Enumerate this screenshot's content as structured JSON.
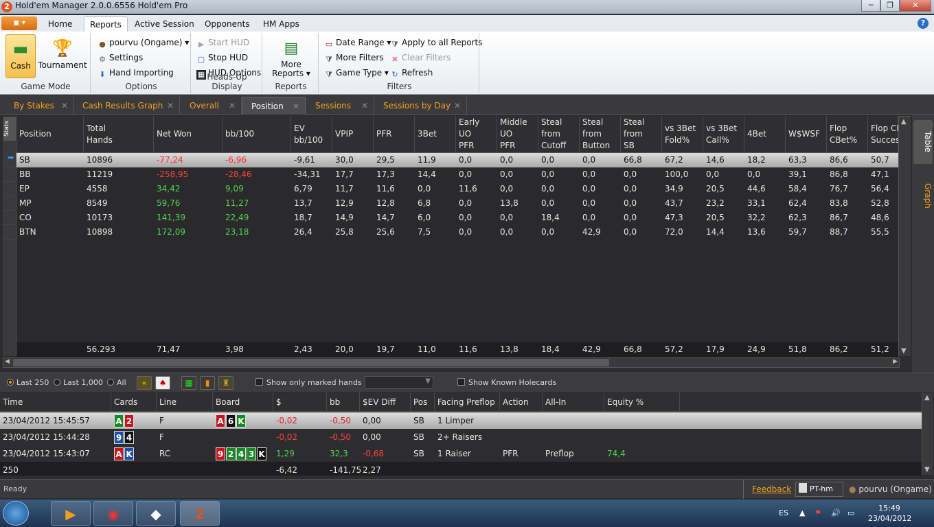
{
  "window": {
    "title": "Hold'em Manager 2.0.0.6556 Hold'em Pro",
    "app_icon": "2",
    "min": "─",
    "max": "❐",
    "close": "✕"
  },
  "ribbon_tabs": [
    "Home",
    "Reports",
    "Active Session",
    "Opponents",
    "HM Apps"
  ],
  "ribbon_active_tab": "Reports",
  "ribbon": {
    "game_mode": {
      "label": "Game Mode",
      "cash": "Cash",
      "tournament": "Tournament"
    },
    "options": {
      "label": "Options",
      "player": "pourvu (Ongame)",
      "settings": "Settings",
      "hand_importing": "Hand Importing"
    },
    "hud": {
      "label": "Heads-Up Display",
      "start": "Start HUD",
      "stop": "Stop HUD",
      "options": "HUD Options"
    },
    "reports": {
      "label": "Reports",
      "more_line1": "More",
      "more_line2": "Reports"
    },
    "filters": {
      "label": "Filters",
      "date_range": "Date Range",
      "more_filters": "More Filters",
      "game_type": "Game Type",
      "apply_all": "Apply to all Reports",
      "clear": "Clear Filters",
      "refresh": "Refresh"
    }
  },
  "doc_tabs": [
    "By Stakes",
    "Cash Results Graph",
    "Overall",
    "Position",
    "Sessions",
    "Sessions by Day"
  ],
  "doc_active": "Position",
  "side_tabs": {
    "stats": "Stats",
    "table": "Table",
    "graph": "Graph"
  },
  "stats": {
    "headers": [
      [
        "Position"
      ],
      [
        "Total",
        "Hands"
      ],
      [
        "Net Won"
      ],
      [
        "bb/100"
      ],
      [
        "EV",
        "bb/100"
      ],
      [
        "VPIP"
      ],
      [
        "PFR"
      ],
      [
        "3Bet"
      ],
      [
        "Early",
        "UO",
        "PFR"
      ],
      [
        "Middle",
        "UO",
        "PFR"
      ],
      [
        "Steal",
        "from",
        "Cutoff"
      ],
      [
        "Steal",
        "from",
        "Button"
      ],
      [
        "Steal",
        "from",
        "SB"
      ],
      [
        "vs 3Bet",
        "Fold%"
      ],
      [
        "vs 3Bet",
        "Call%"
      ],
      [
        "4Bet"
      ],
      [
        "W$WSF"
      ],
      [
        "Flop",
        "CBet%"
      ],
      [
        "Flop CB",
        "Success"
      ]
    ],
    "rows": [
      [
        "SB",
        "10896",
        "-77,24",
        "-6,96",
        "-9,61",
        "30,0",
        "29,5",
        "11,9",
        "0,0",
        "0,0",
        "0,0",
        "0,0",
        "66,8",
        "67,2",
        "14,6",
        "18,2",
        "63,3",
        "86,6",
        "50,7"
      ],
      [
        "BB",
        "11219",
        "-258,95",
        "-28,46",
        "-34,31",
        "17,7",
        "17,3",
        "14,4",
        "0,0",
        "0,0",
        "0,0",
        "0,0",
        "0,0",
        "100,0",
        "0,0",
        "0,0",
        "39,1",
        "86,8",
        "47,1"
      ],
      [
        "EP",
        "4558",
        "34,42",
        "9,09",
        "6,79",
        "11,7",
        "11,6",
        "0,0",
        "11,6",
        "0,0",
        "0,0",
        "0,0",
        "0,0",
        "34,9",
        "20,5",
        "44,6",
        "58,4",
        "76,7",
        "56,4"
      ],
      [
        "MP",
        "8549",
        "59,76",
        "11,27",
        "13,7",
        "12,9",
        "12,8",
        "6,8",
        "0,0",
        "13,8",
        "0,0",
        "0,0",
        "0,0",
        "43,7",
        "23,2",
        "33,1",
        "62,4",
        "83,8",
        "52,8"
      ],
      [
        "CO",
        "10173",
        "141,39",
        "22,49",
        "18,7",
        "14,9",
        "14,7",
        "6,0",
        "0,0",
        "0,0",
        "18,4",
        "0,0",
        "0,0",
        "47,3",
        "20,5",
        "32,2",
        "62,3",
        "86,7",
        "48,6"
      ],
      [
        "BTN",
        "10898",
        "172,09",
        "23,18",
        "26,4",
        "25,8",
        "25,6",
        "7,5",
        "0,0",
        "0,0",
        "0,0",
        "42,9",
        "0,0",
        "72,0",
        "14,4",
        "13,6",
        "59,7",
        "88,7",
        "55,5"
      ]
    ],
    "totals": [
      "",
      "56.293",
      "71,47",
      "3,98",
      "2,43",
      "20,0",
      "19,7",
      "11,0",
      "11,6",
      "13,8",
      "18,4",
      "42,9",
      "66,8",
      "57,2",
      "17,9",
      "24,9",
      "51,8",
      "86,2",
      "51,2"
    ],
    "selected_row_indicator": "➡"
  },
  "handbar": {
    "last250": "Last 250",
    "last1000": "Last 1,000",
    "all": "All",
    "marked": "Show only marked hands",
    "holecards": "Show Known Holecards"
  },
  "hands": {
    "headers": [
      "Time",
      "Cards",
      "Line",
      "Board",
      "$",
      "bb",
      "$EV Diff",
      "Pos",
      "Facing Preflop",
      "Action",
      "All-In",
      "Equity %"
    ],
    "rows": [
      {
        "time": "23/04/2012 15:45:57",
        "cards": [
          [
            "A",
            "g"
          ],
          [
            "2",
            "r"
          ]
        ],
        "line": "F",
        "board": [
          [
            "A",
            "r"
          ],
          [
            "6",
            "k"
          ],
          [
            "K",
            "g"
          ]
        ],
        "usd": "-0,02",
        "bb": "-0,50",
        "evdiff": "0,00",
        "pos": "SB",
        "facing": "1 Limper",
        "action": "",
        "allin": "",
        "equity": ""
      },
      {
        "time": "23/04/2012 15:44:28",
        "cards": [
          [
            "9",
            "b"
          ],
          [
            "4",
            "k"
          ]
        ],
        "line": "F",
        "board": [],
        "usd": "-0,02",
        "bb": "-0,50",
        "evdiff": "0,00",
        "pos": "SB",
        "facing": "2+ Raisers",
        "action": "",
        "allin": "",
        "equity": ""
      },
      {
        "time": "23/04/2012 15:43:07",
        "cards": [
          [
            "A",
            "r"
          ],
          [
            "K",
            "b"
          ]
        ],
        "line": "RC",
        "board": [
          [
            "9",
            "r"
          ],
          [
            "2",
            "g"
          ],
          [
            "4",
            "g"
          ],
          [
            "3",
            "g"
          ],
          [
            "K",
            "k"
          ]
        ],
        "usd": "1,29",
        "bb": "32,3",
        "evdiff": "-0,68",
        "pos": "SB",
        "facing": "1 Raiser",
        "action": "PFR",
        "allin": "Preflop",
        "equity": "74,4"
      }
    ],
    "totals": {
      "count": "250",
      "usd": "-6,42",
      "bb": "-141,75",
      "evdiff": "2,27"
    }
  },
  "status": {
    "ready": "Ready",
    "feedback": "Feedback",
    "db": "PT-hm",
    "player": "pourvu (Ongame)"
  },
  "taskbar": {
    "lang": "ES",
    "time": "15:49",
    "date": "23/04/2012"
  }
}
